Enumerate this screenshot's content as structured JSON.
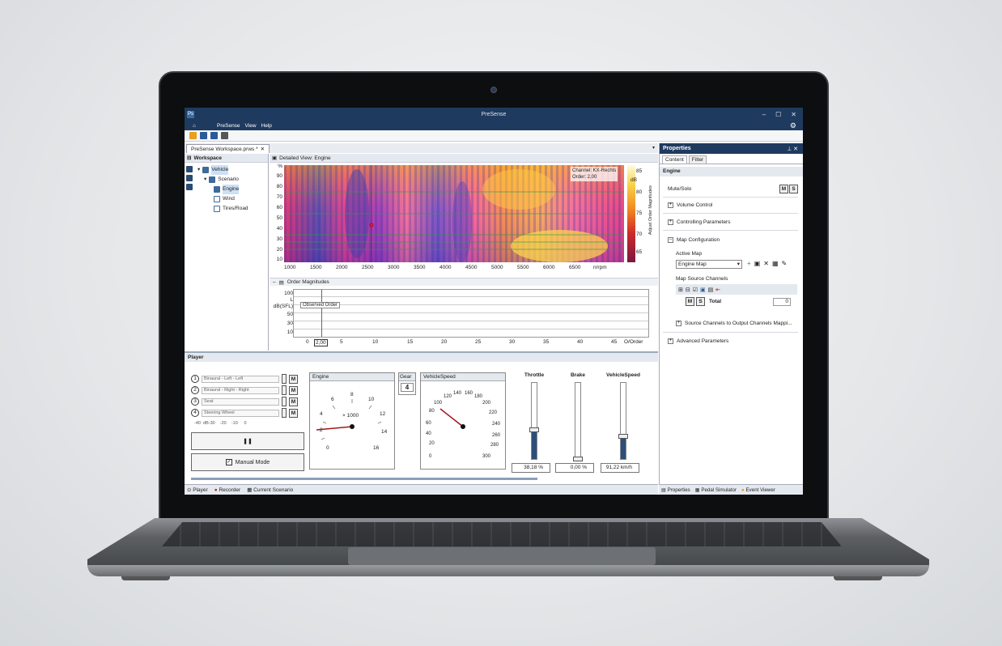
{
  "window": {
    "title": "PreSense"
  },
  "menu": [
    "PreSense",
    "View",
    "Help"
  ],
  "doc_tab": "PreSense Workspace.prws *",
  "workspace": {
    "header": "Workspace",
    "tree": [
      "Vehicle",
      "Scenario",
      "Engine",
      "Wind",
      "Tires/Road"
    ]
  },
  "detail": {
    "header": "Detailed View: Engine",
    "y_unit": "%",
    "y_ticks": [
      "90",
      "80",
      "70",
      "60",
      "50",
      "40",
      "30",
      "20",
      "10"
    ],
    "x_ticks": [
      "1000",
      "1500",
      "2000",
      "2500",
      "3000",
      "3500",
      "4000",
      "4500",
      "5000",
      "5500",
      "6000",
      "6500"
    ],
    "x_unit": "n/rpm",
    "colorbar_ticks": [
      "85",
      "80",
      "75",
      "70",
      "65"
    ],
    "colorbar_unit": "dB",
    "side_label": "Adjust Order Magnitudes",
    "annotation_line1": "Channel: KX-Rechts",
    "annotation_line2": "Order: 2,00"
  },
  "order": {
    "header": "Order Magnitudes",
    "y_ticks": [
      "100",
      "L",
      "dB(SFL)",
      "50",
      "30",
      "10"
    ],
    "x_ticks": [
      "0",
      "2,00",
      "5",
      "10",
      "15",
      "20",
      "25",
      "30",
      "35",
      "40",
      "45",
      "O/Order"
    ],
    "label": "Observed Order"
  },
  "player": {
    "header": "Player",
    "channels": [
      {
        "num": "1",
        "name": "Binaural - Left - Left",
        "m": "M"
      },
      {
        "num": "2",
        "name": "Binaural - Right - Right",
        "m": "M"
      },
      {
        "num": "3",
        "name": "Seat",
        "m": "M"
      },
      {
        "num": "4",
        "name": "Steering Wheel",
        "m": "M"
      }
    ],
    "scale": "-40  dB-30    -20    -10     0",
    "pause": "❚❚",
    "manual": "Manual Mode",
    "engine": {
      "title": "Engine",
      "ticks": [
        "2",
        "4",
        "6",
        "8",
        "10",
        "12",
        "14",
        "16",
        "0"
      ],
      "unit": "× 1000"
    },
    "gear": {
      "title": "Gear",
      "value": "4"
    },
    "speed": {
      "title": "VehicleSpeed",
      "ticks": [
        "0",
        "20",
        "40",
        "60",
        "80",
        "100",
        "120",
        "140",
        "160",
        "180",
        "200",
        "220",
        "240",
        "260",
        "280",
        "300"
      ]
    },
    "sliders": [
      {
        "label": "Throttle",
        "value": "38,18 %",
        "level": 0.3818
      },
      {
        "label": "Brake",
        "value": "0,00 %",
        "level": 0.0
      },
      {
        "label": "VehicleSpeed",
        "value": "91,22 km/h",
        "level": 0.3
      }
    ]
  },
  "bottom_tabs": [
    "Player",
    "Recorder",
    "Current Scenario"
  ],
  "properties": {
    "header": "Properties",
    "tabs": [
      "Content",
      "Filter"
    ],
    "section": "Engine",
    "mute_solo": "Mute/Solo",
    "m": "M",
    "s": "S",
    "volume": "Volume Control",
    "controlling": "Controlling Parameters",
    "map_config": "Map Configuration",
    "active_map": "Active Map",
    "active_map_value": "Engine Map",
    "map_source": "Map Source Channels",
    "total": "Total",
    "total_value": "0",
    "source_to_output": "Source Channels to Output Channels Mappi...",
    "advanced": "Advanced Parameters"
  },
  "prop_tabs": [
    "Properties",
    "Pedal Simulator",
    "Event Viewer"
  ]
}
